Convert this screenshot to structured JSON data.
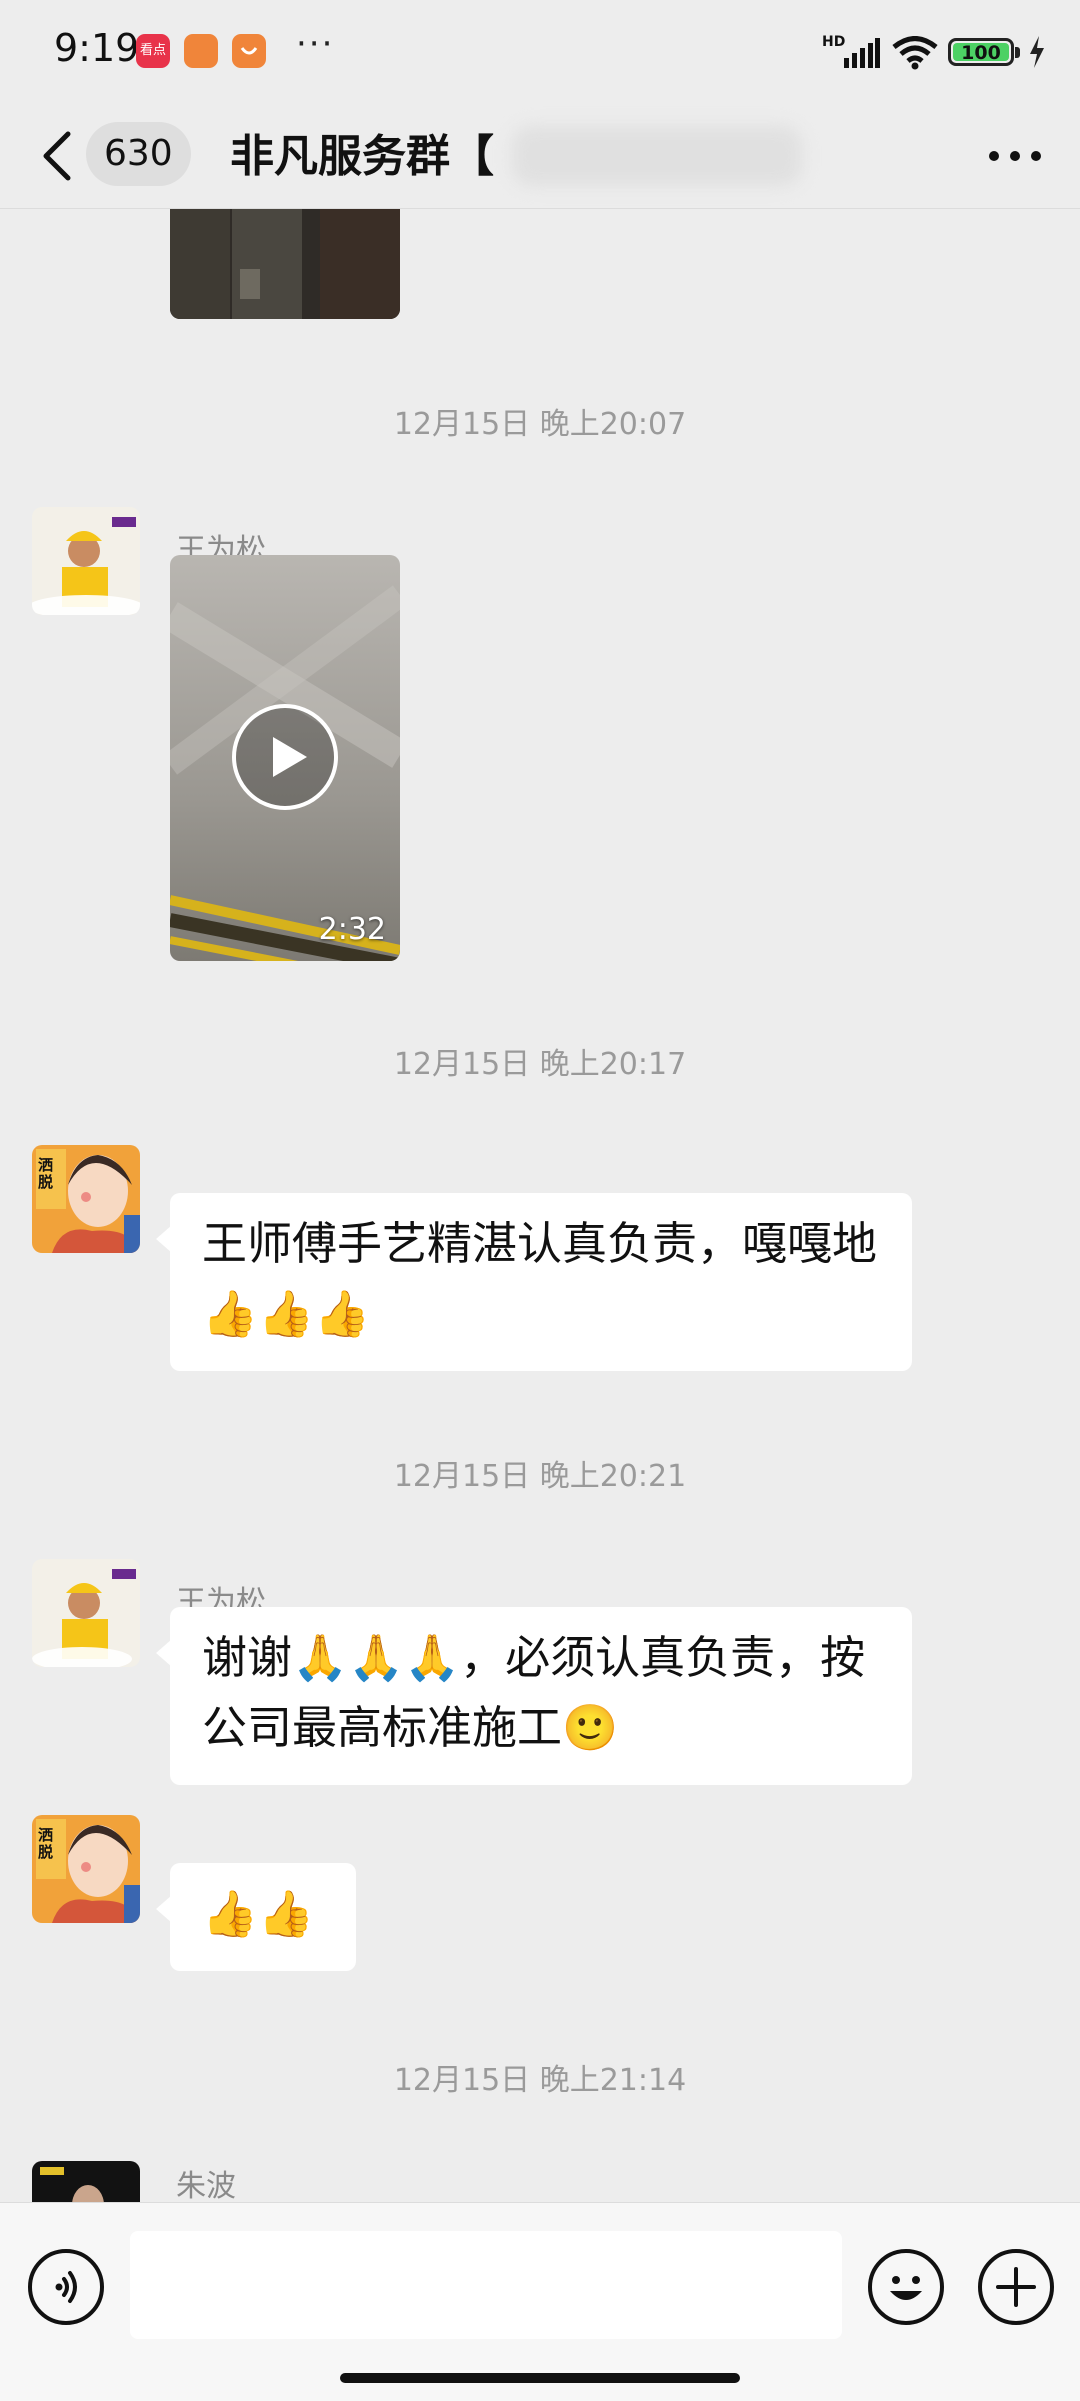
{
  "status_bar": {
    "time": "9:19",
    "app_badges": [
      {
        "label": "看点",
        "color": "#e8334a"
      },
      {
        "label": "",
        "color": "#f0853a"
      },
      {
        "label": "",
        "color": "#f0853a"
      }
    ],
    "more": "···",
    "network": "HD",
    "battery": "100"
  },
  "nav": {
    "back_icon": "chevron-left-icon",
    "unread_count": "630",
    "title": "非凡服务群【",
    "more_icon": "ellipsis-icon"
  },
  "chat": {
    "top_video_partial": {
      "visible": true
    },
    "messages": [
      {
        "type": "timestamp",
        "text": "12月15日 晚上20:07"
      },
      {
        "type": "video",
        "sender": "王为松",
        "duration": "2:32"
      },
      {
        "type": "timestamp",
        "text": "12月15日 晚上20:17"
      },
      {
        "type": "text",
        "avatar_label": "洒脱",
        "text_line1": "王师傅手艺精湛认真负责，嘎嘎地",
        "text_line2": "👍👍👍"
      },
      {
        "type": "timestamp",
        "text": "12月15日 晚上20:21"
      },
      {
        "type": "text",
        "sender": "王为松",
        "text_line1": "谢谢🙏🙏🙏，必须认真负责，按",
        "text_line2": "公司最高标准施工🙂"
      },
      {
        "type": "text",
        "avatar_label": "洒脱",
        "text_line1": "👍👍"
      },
      {
        "type": "timestamp",
        "text": "12月15日 晚上21:14"
      },
      {
        "type": "partial",
        "sender": "朱波"
      }
    ]
  },
  "input_bar": {
    "voice_icon": "voice-icon",
    "emoji_icon": "smiley-icon",
    "plus_icon": "plus-icon"
  },
  "colors": {
    "background": "#ededed",
    "bubble": "#ffffff",
    "timestamp": "#9a9a9a",
    "sender_name": "#8a8a8a",
    "uniform_yellow": "#f5c518"
  }
}
